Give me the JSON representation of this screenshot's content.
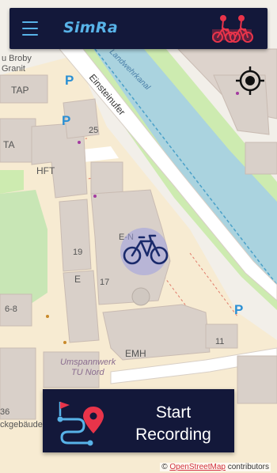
{
  "app": {
    "title": "SimRa"
  },
  "map": {
    "labels": {
      "broby": "u Broby",
      "granit": "Granit",
      "tap": "TAP",
      "ta": "TA",
      "hft": "HFT",
      "house_25": "25",
      "house_19": "19",
      "e": "E",
      "house_17": "17",
      "en": "E-N",
      "house_6_8": "6-8",
      "emh": "EMH",
      "house_11": "11",
      "house_36": "36",
      "umspannwerk_line1": "Umspannwerk",
      "umspannwerk_line2": "TU Nord",
      "street": "Einsteinufer",
      "canal": "Landwehrkanal",
      "gebaeude": "ckgebäude",
      "parking": "P"
    }
  },
  "record_button": {
    "line1": "Start",
    "line2": "Recording"
  },
  "attribution": {
    "prefix": "©",
    "link": "OpenStreetMap",
    "suffix": "contributors"
  },
  "colors": {
    "app_bar": "#13183a",
    "accent": "#58b3e8",
    "accent_red": "#e8344a",
    "water": "#aad3df",
    "road": "#ffffff",
    "building": "#d9d0c9",
    "landuse": "#f8ead0"
  },
  "icons": {
    "menu": "hamburger-menu-icon",
    "logo": "cyclists-logo-icon",
    "locate": "crosshair-locate-icon",
    "position": "bicycle-icon",
    "record": "route-flag-pin-icon"
  }
}
